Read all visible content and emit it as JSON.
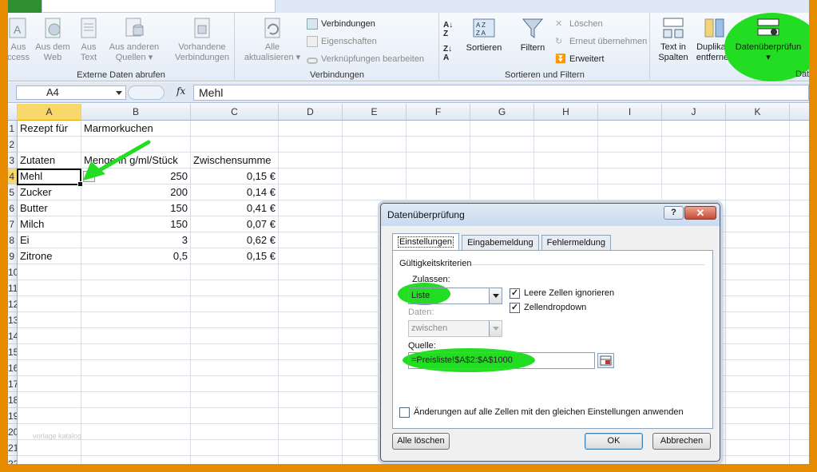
{
  "ribbon": {
    "groups": {
      "external_data": "Externe Daten abrufen",
      "connections": "Verbindungen",
      "sort_filter": "Sortieren und Filtern",
      "data_tools_partial": "Dat"
    },
    "btn_access": [
      "Aus",
      "ccess"
    ],
    "btn_web": [
      "Aus dem",
      "Web"
    ],
    "btn_text": [
      "Aus",
      "Text"
    ],
    "btn_other": [
      "Aus anderen",
      "Quellen"
    ],
    "btn_existing": [
      "Vorhandene",
      "Verbindungen"
    ],
    "btn_refresh": [
      "Alle",
      "aktualisieren"
    ],
    "conn_connections": "Verbindungen",
    "conn_properties": "Eigenschaften",
    "conn_edit_links": "Verknüpfungen bearbeiten",
    "sort_label": "Sortieren",
    "filter_label": "Filtern",
    "clear_label": "Löschen",
    "reapply_label": "Erneut übernehmen",
    "advanced_label": "Erweitert",
    "text_to_columns": [
      "Text in",
      "Spalten"
    ],
    "remove_duplicates": [
      "Duplikate",
      "entfernen"
    ],
    "data_validation": "Datenüberprüfun"
  },
  "formula_bar": {
    "name_box": "A4",
    "fx": "fx",
    "content": "Mehl"
  },
  "sheet": {
    "columns": [
      "A",
      "B",
      "C",
      "D",
      "E",
      "F",
      "G",
      "H",
      "I",
      "J",
      "K"
    ],
    "row_numbers": [
      "1",
      "2",
      "3",
      "4",
      "5",
      "6",
      "7",
      "8",
      "9",
      "10",
      "11",
      "12",
      "13",
      "14",
      "15",
      "16",
      "17",
      "18",
      "19",
      "20",
      "21",
      "22"
    ],
    "a1": "Rezept für",
    "b1": "Marmorkuchen",
    "a3": "Zutaten",
    "b3": "Menge in g/ml/Stück",
    "c3": "Zwischensumme",
    "rows": [
      {
        "a": "Mehl",
        "b": "250",
        "c": "0,15 €"
      },
      {
        "a": "Zucker",
        "b": "200",
        "c": "0,14 €"
      },
      {
        "a": "Butter",
        "b": "150",
        "c": "0,41 €"
      },
      {
        "a": "Milch",
        "b": "150",
        "c": "0,07 €"
      },
      {
        "a": "Ei",
        "b": "3",
        "c": "0,62 €"
      },
      {
        "a": "Zitrone",
        "b": "0,5",
        "c": "0,15 €"
      }
    ],
    "watermark": "vorlage katalog"
  },
  "dialog": {
    "title": "Datenüberprüfung",
    "help": "?",
    "close": "✕",
    "tabs": [
      "Einstellungen",
      "Eingabemeldung",
      "Fehlermeldung"
    ],
    "section": "Gültigkeitskriterien",
    "allow_label": "Zulassen:",
    "allow_value": "Liste",
    "ignore_blank": "Leere Zellen ignorieren",
    "in_cell_dropdown": "Zellendropdown",
    "data_label": "Daten:",
    "data_value": "zwischen",
    "source_label": "Quelle:",
    "source_value": "=Preisliste!$A$2:$A$1000",
    "apply_all": "Änderungen auf alle Zellen mit den gleichen Einstellungen anwenden",
    "clear_all": "Alle löschen",
    "ok": "OK",
    "cancel": "Abbrechen"
  },
  "colors": {
    "frame": "#e68a00",
    "highlight": "#22dd22",
    "selected_header": "#f8d86a"
  }
}
